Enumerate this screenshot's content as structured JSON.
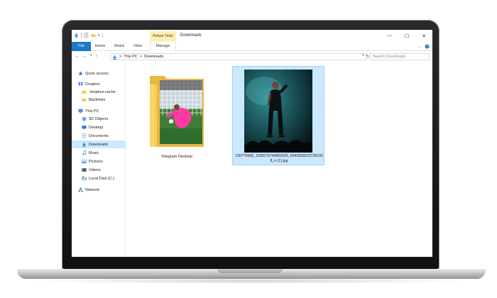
{
  "window": {
    "title": "Downloads",
    "contextual_tab_group": "Picture Tools",
    "controls": {
      "minimize": "—",
      "maximize": "☐",
      "close": "✕"
    }
  },
  "ribbon": {
    "tabs": [
      {
        "label": "File",
        "active": true
      },
      {
        "label": "Home"
      },
      {
        "label": "Share"
      },
      {
        "label": "View"
      },
      {
        "label": "Manage"
      }
    ],
    "expand_icon": "chevron-down-icon",
    "help_icon": "help-icon"
  },
  "address": {
    "back": "←",
    "forward": "→",
    "recent": "˅",
    "up": "↑",
    "path": [
      "This PC",
      "Downloads"
    ],
    "separator": ">",
    "dropdown": "˅",
    "refresh": "↻",
    "search_placeholder": "Search Downloads"
  },
  "nav": {
    "items": [
      {
        "label": "Quick access",
        "icon": "star-icon",
        "level": 0
      },
      {
        "label": "Dropbox",
        "icon": "dropbox-icon",
        "level": 0
      },
      {
        "label": ".dropbox.cache",
        "icon": "folder-icon",
        "level": 1
      },
      {
        "label": "Backlinks",
        "icon": "folder-icon",
        "level": 1
      },
      {
        "label": "This PC",
        "icon": "computer-icon",
        "level": 0
      },
      {
        "label": "3D Objects",
        "icon": "cube-icon",
        "level": 1
      },
      {
        "label": "Desktop",
        "icon": "desktop-icon",
        "level": 1
      },
      {
        "label": "Documents",
        "icon": "documents-icon",
        "level": 1
      },
      {
        "label": "Downloads",
        "icon": "download-icon",
        "level": 1,
        "selected": true
      },
      {
        "label": "Music",
        "icon": "music-icon",
        "level": 1
      },
      {
        "label": "Pictures",
        "icon": "pictures-icon",
        "level": 1
      },
      {
        "label": "Videos",
        "icon": "videos-icon",
        "level": 1
      },
      {
        "label": "Local Disk (C:)",
        "icon": "disk-icon",
        "level": 1
      },
      {
        "label": "Network",
        "icon": "network-icon",
        "level": 0
      }
    ]
  },
  "files": [
    {
      "name": "Telegram Desktop",
      "type": "folder",
      "thumbnail": "goalkeeper-photo"
    },
    {
      "name": "130770968_1035078749802005_6543558023736105 8_n (1).jpg",
      "type": "image",
      "selected": true,
      "thumbnail": "concert-performer-photo"
    }
  ],
  "colors": {
    "accent": "#1979ca",
    "selection": "#cce8ff",
    "selection_border": "#99d1ff",
    "contextual_tab": "#fbf0b3",
    "folder": "#f6cd5b"
  }
}
